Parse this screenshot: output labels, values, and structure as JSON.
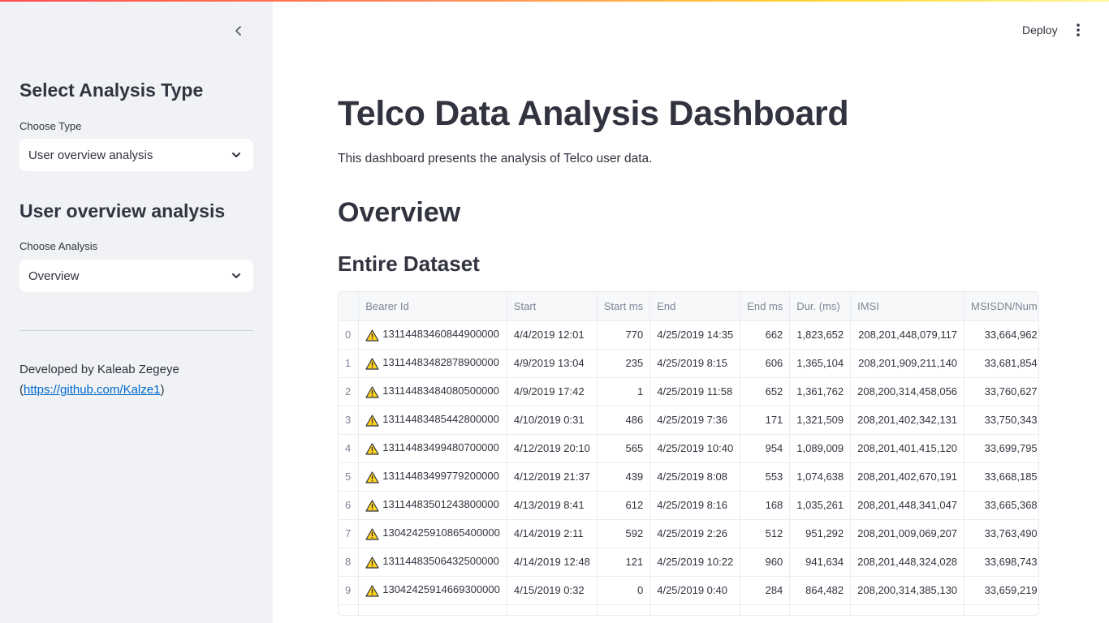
{
  "sidebar": {
    "analysis_type_heading": "Select Analysis Type",
    "choose_type_label": "Choose Type",
    "choose_type_value": "User overview analysis",
    "section_heading": "User overview analysis",
    "choose_analysis_label": "Choose Analysis",
    "choose_analysis_value": "Overview",
    "credit_prefix": "Developed by Kaleab Zegeye (",
    "credit_link": "https://github.com/Kalze1",
    "credit_suffix": ")"
  },
  "header": {
    "deploy_label": "Deploy",
    "menu_icon": "kebab-menu-icon"
  },
  "main": {
    "title": "Telco Data Analysis Dashboard",
    "description": "This dashboard presents the analysis of Telco user data.",
    "section_title": "Overview",
    "subsection_title": "Entire Dataset"
  },
  "colors": {
    "sidebar_bg": "#f0f2f6",
    "text": "#31333f",
    "link": "#0068c9",
    "header_text": "#808495"
  },
  "table": {
    "columns": [
      "",
      "Bearer Id",
      "Start",
      "Start ms",
      "End",
      "End ms",
      "Dur. (ms)",
      "IMSI",
      "MSISDN/Num"
    ],
    "rows": [
      [
        "0",
        "13114483460844900000",
        "4/4/2019 12:01",
        "770",
        "4/25/2019 14:35",
        "662",
        "1,823,652",
        "208,201,448,079,117",
        "33,664,962"
      ],
      [
        "1",
        "13114483482878900000",
        "4/9/2019 13:04",
        "235",
        "4/25/2019 8:15",
        "606",
        "1,365,104",
        "208,201,909,211,140",
        "33,681,854"
      ],
      [
        "2",
        "13114483484080500000",
        "4/9/2019 17:42",
        "1",
        "4/25/2019 11:58",
        "652",
        "1,361,762",
        "208,200,314,458,056",
        "33,760,627"
      ],
      [
        "3",
        "13114483485442800000",
        "4/10/2019 0:31",
        "486",
        "4/25/2019 7:36",
        "171",
        "1,321,509",
        "208,201,402,342,131",
        "33,750,343"
      ],
      [
        "4",
        "13114483499480700000",
        "4/12/2019 20:10",
        "565",
        "4/25/2019 10:40",
        "954",
        "1,089,009",
        "208,201,401,415,120",
        "33,699,795"
      ],
      [
        "5",
        "13114483499779200000",
        "4/12/2019 21:37",
        "439",
        "4/25/2019 8:08",
        "553",
        "1,074,638",
        "208,201,402,670,191",
        "33,668,185"
      ],
      [
        "6",
        "13114483501243800000",
        "4/13/2019 8:41",
        "612",
        "4/25/2019 8:16",
        "168",
        "1,035,261",
        "208,201,448,341,047",
        "33,665,368"
      ],
      [
        "7",
        "13042425910865400000",
        "4/14/2019 2:11",
        "592",
        "4/25/2019 2:26",
        "512",
        "951,292",
        "208,201,009,069,207",
        "33,763,490"
      ],
      [
        "8",
        "13114483506432500000",
        "4/14/2019 12:48",
        "121",
        "4/25/2019 10:22",
        "960",
        "941,634",
        "208,201,448,324,028",
        "33,698,743"
      ],
      [
        "9",
        "13042425914669300000",
        "4/15/2019 0:32",
        "0",
        "4/25/2019 0:40",
        "284",
        "864,482",
        "208,200,314,385,130",
        "33,659,219"
      ],
      [
        "",
        "",
        "",
        "",
        "",
        "",
        "",
        "",
        ""
      ]
    ]
  }
}
